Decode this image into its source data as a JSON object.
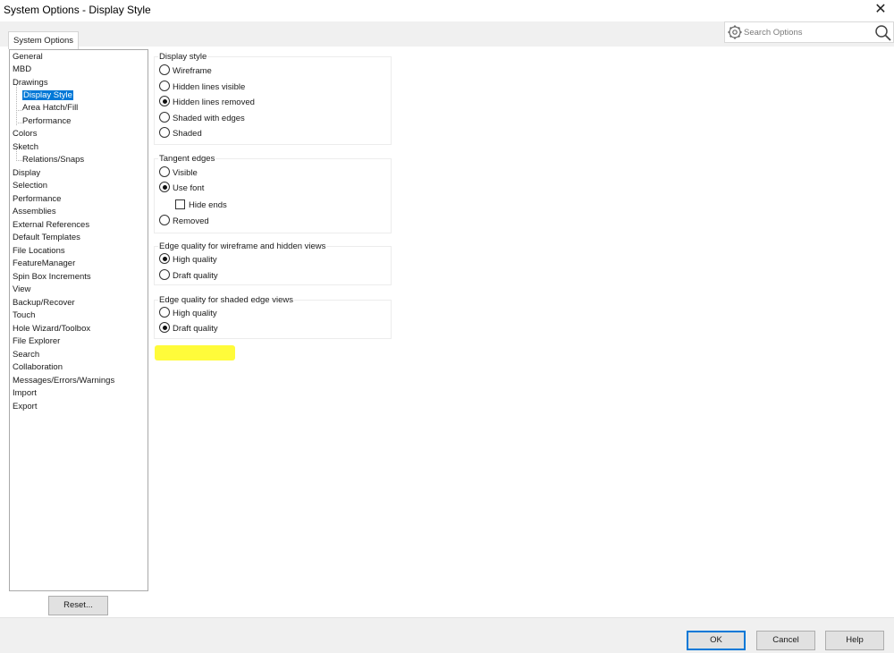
{
  "window": {
    "title": "System Options - Display Style",
    "close_glyph": "✕"
  },
  "tabs": [
    {
      "label": "System Options",
      "active": true
    }
  ],
  "search": {
    "placeholder": "Search Options",
    "left_icon": "gear-icon",
    "right_icon": "search-icon"
  },
  "tree": {
    "items": [
      {
        "label": "General",
        "level": 0
      },
      {
        "label": "MBD",
        "level": 0
      },
      {
        "label": "Drawings",
        "level": 0
      },
      {
        "label": "Display Style",
        "level": 1,
        "selected": true
      },
      {
        "label": "Area Hatch/Fill",
        "level": 1
      },
      {
        "label": "Performance",
        "level": 1
      },
      {
        "label": "Colors",
        "level": 0
      },
      {
        "label": "Sketch",
        "level": 0
      },
      {
        "label": "Relations/Snaps",
        "level": 1
      },
      {
        "label": "Display",
        "level": 0
      },
      {
        "label": "Selection",
        "level": 0
      },
      {
        "label": "Performance",
        "level": 0
      },
      {
        "label": "Assemblies",
        "level": 0
      },
      {
        "label": "External References",
        "level": 0
      },
      {
        "label": "Default Templates",
        "level": 0
      },
      {
        "label": "File Locations",
        "level": 0
      },
      {
        "label": "FeatureManager",
        "level": 0
      },
      {
        "label": "Spin Box Increments",
        "level": 0
      },
      {
        "label": "View",
        "level": 0
      },
      {
        "label": "Backup/Recover",
        "level": 0
      },
      {
        "label": "Touch",
        "level": 0
      },
      {
        "label": "Hole Wizard/Toolbox",
        "level": 0
      },
      {
        "label": "File Explorer",
        "level": 0
      },
      {
        "label": "Search",
        "level": 0
      },
      {
        "label": "Collaboration",
        "level": 0
      },
      {
        "label": "Messages/Errors/Warnings",
        "level": 0
      },
      {
        "label": "Import",
        "level": 0
      },
      {
        "label": "Export",
        "level": 0
      }
    ]
  },
  "reset_label": "Reset...",
  "groups": {
    "display_style": {
      "title": "Display style",
      "options": [
        {
          "label": "Wireframe",
          "selected": false
        },
        {
          "label": "Hidden lines visible",
          "selected": false
        },
        {
          "label": "Hidden lines removed",
          "selected": true
        },
        {
          "label": "Shaded with edges",
          "selected": false
        },
        {
          "label": "Shaded",
          "selected": false
        }
      ]
    },
    "tangent_edges": {
      "title": "Tangent edges",
      "options": [
        {
          "label": "Visible",
          "selected": false
        },
        {
          "label": "Use font",
          "selected": true
        },
        {
          "label": "Removed",
          "selected": false
        }
      ],
      "hide_ends": {
        "label": "Hide ends",
        "checked": false
      }
    },
    "edge_quality_wireframe": {
      "title": "Edge quality for wireframe and hidden views",
      "options": [
        {
          "label": "High quality",
          "selected": true
        },
        {
          "label": "Draft quality",
          "selected": false
        }
      ]
    },
    "edge_quality_shaded": {
      "title": "Edge quality for shaded edge views",
      "options": [
        {
          "label": "High quality",
          "selected": false
        },
        {
          "label": "Draft quality",
          "selected": true
        }
      ],
      "highlight_color": "#fffb3a"
    }
  },
  "footer": {
    "ok": "OK",
    "cancel": "Cancel",
    "help": "Help"
  },
  "colors": {
    "selection": "#0078d7",
    "dialog_bg": "#f0f0f0",
    "highlight": "#fffb3a"
  }
}
